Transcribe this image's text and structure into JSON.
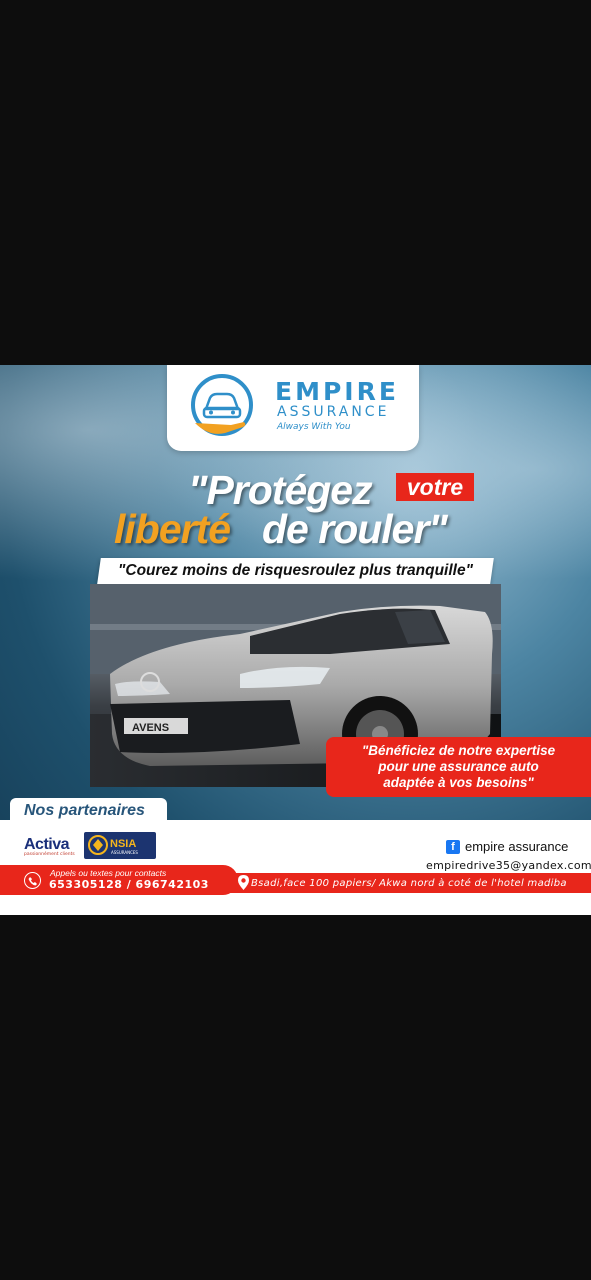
{
  "brand": {
    "name": "EMPIRE",
    "subtitle": "ASSURANCE",
    "tagline": "Always With You"
  },
  "headline": {
    "line1": "\"Protégez",
    "highlight": "votre",
    "line2a": "liberté",
    "line2b": "de rouler\""
  },
  "subheadline": "\"Courez moins de risquesroulez plus tranquille\"",
  "car": {
    "badge": "AVENS"
  },
  "expertise": {
    "line1": "\"Bénéficiez de notre expertise",
    "line2": "pour une assurance auto",
    "line3": "adaptée à vos besoins\""
  },
  "partners": {
    "title": "Nos partenaires",
    "items": [
      {
        "name": "Activa",
        "tagline": "passionnément clients"
      },
      {
        "name": "NSIA",
        "tagline": "ASSURANCES"
      }
    ]
  },
  "social": {
    "facebook": "empire assurance",
    "email": "empiredrive35@yandex.com"
  },
  "contact": {
    "label": "Appels ou textes pour contacts",
    "phones": "653305128 / 696742103",
    "address": "Bsadi,face 100 papiers/ Akwa nord à coté de l'hotel madiba"
  },
  "colors": {
    "accent_red": "#e8261b",
    "accent_orange": "#f2a121",
    "brand_blue": "#2f8fc9"
  }
}
